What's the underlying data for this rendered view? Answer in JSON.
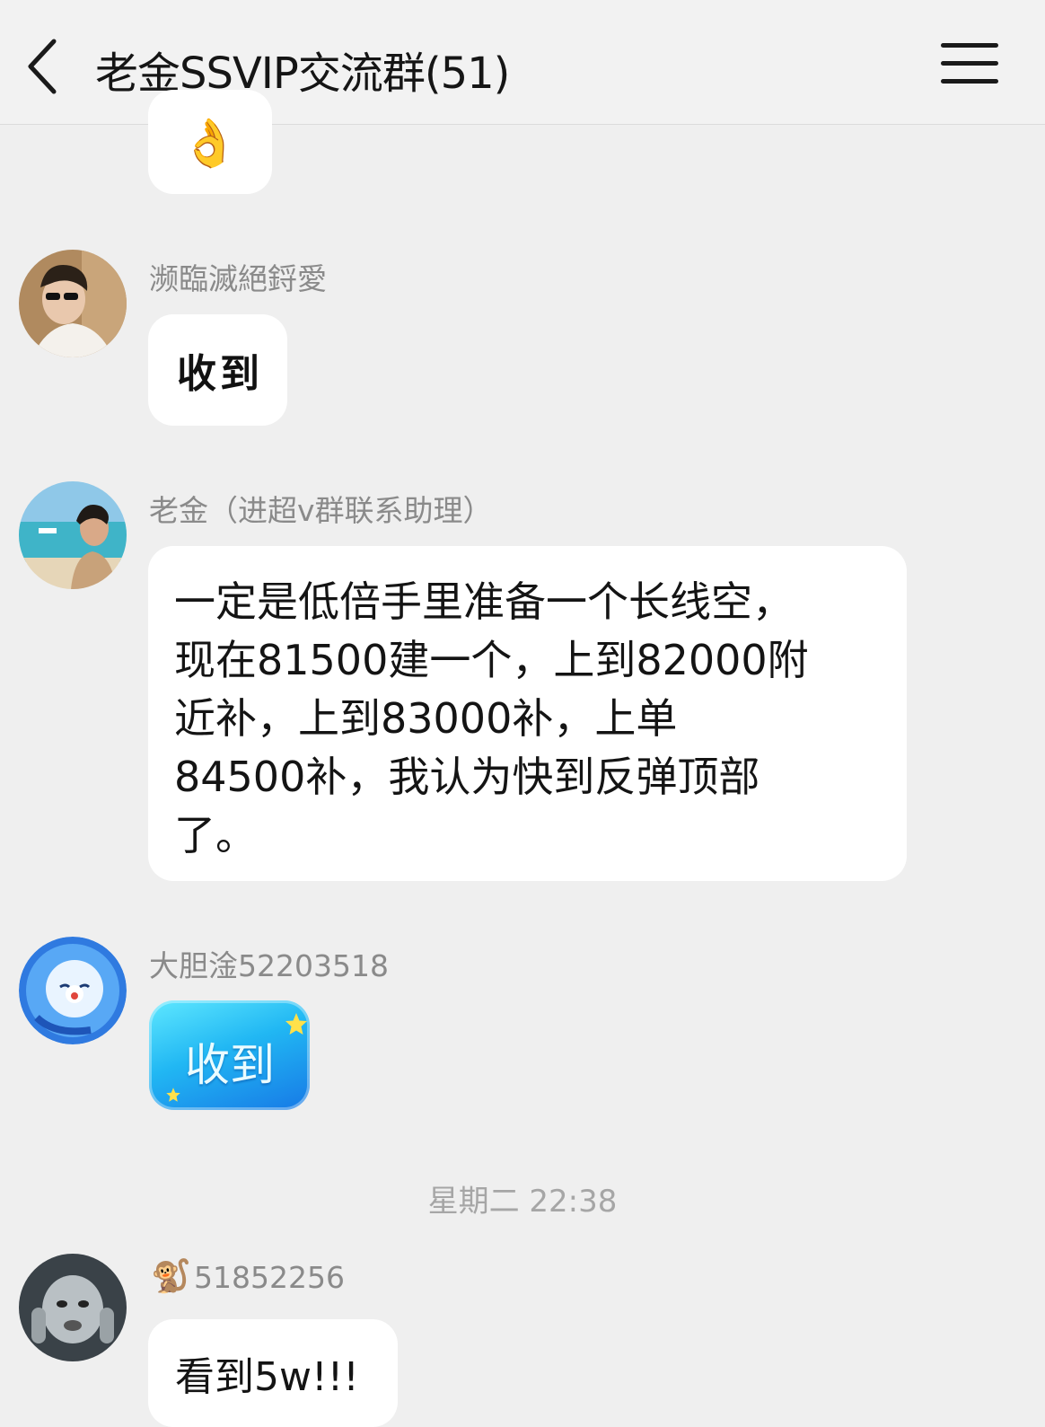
{
  "header": {
    "title": "老金SSVIP交流群(51)",
    "back_icon": "chevron-left-icon",
    "menu_icon": "hamburger-menu-icon"
  },
  "messages": [
    {
      "type": "emoji",
      "emoji": "👌"
    },
    {
      "sender": "濒臨滅絕鋝愛",
      "text": "收到",
      "style": "handwritten"
    },
    {
      "sender": "老金（进超v群联系助理）",
      "lines": [
        "一定是低倍手里准备一个长线空，",
        "现在81500建一个，上到82000附",
        "近补，上到83000补，上单",
        "84500补，我认为快到反弹顶部",
        "了。"
      ]
    },
    {
      "sender": "大胆淦52203518",
      "text": "收到",
      "style": "sticker-bubble"
    },
    {
      "sender_emoji": "🐒",
      "sender": "51852256",
      "text": "看到5w!!!"
    }
  ],
  "timestamp": "星期二 22:38",
  "colors": {
    "background": "#efefef",
    "bubble": "#ffffff",
    "sender": "#8a8a8a",
    "sticker": "#21b7f3"
  }
}
